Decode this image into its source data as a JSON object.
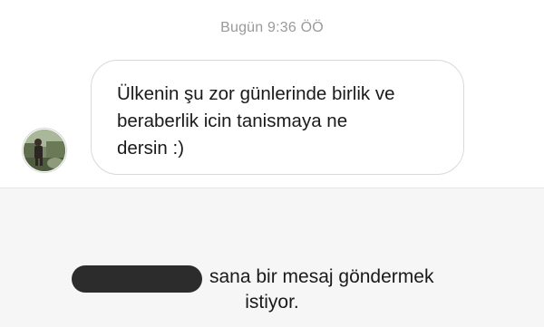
{
  "conversation": {
    "timestamp": "Bugün 9:36 ÖÖ",
    "incoming_message": {
      "sender_avatar": "profile-photo",
      "text": "Ülkenin şu zor günlerinde birlik ve\nberaberlik icin tanismaya ne\ndersin :)"
    }
  },
  "message_request": {
    "sender_name_redacted": true,
    "line1": "sana bir mesaj göndermek",
    "line2": "istiyor."
  },
  "colors": {
    "timestamp": "#9a9a9a",
    "bubble_border": "#d9d9d9",
    "text": "#1a1a1a",
    "panel_background": "#f6f6f6",
    "redaction": "#2c2c2c"
  }
}
